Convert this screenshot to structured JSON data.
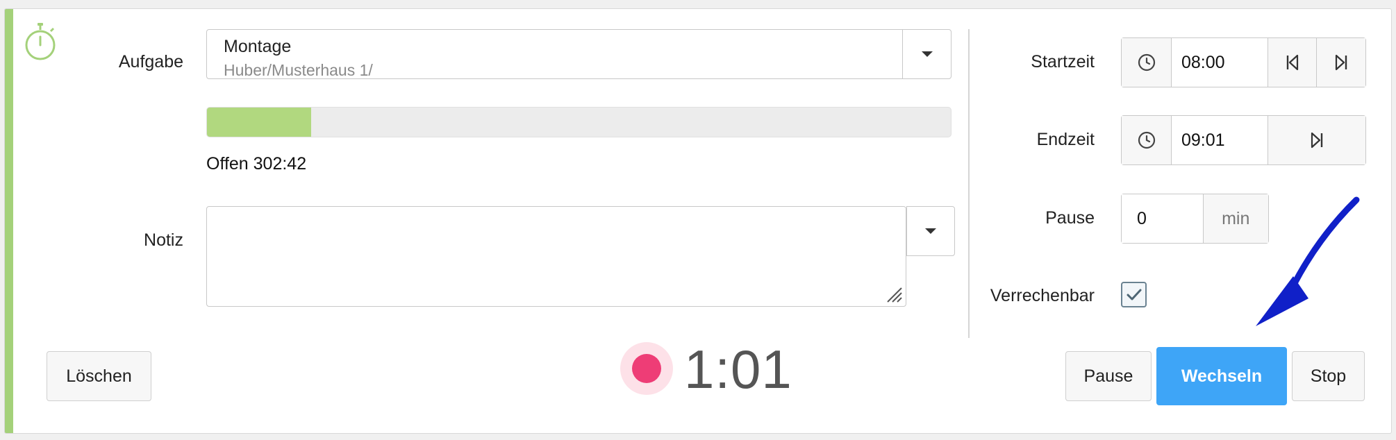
{
  "colors": {
    "accent_green": "#a4d17a",
    "progress_green": "#b1d87f",
    "primary_blue": "#3ea5f7",
    "record_pink": "#ee3d76",
    "annotation_arrow": "#1020c8"
  },
  "form": {
    "aufgabe_label": "Aufgabe",
    "aufgabe_value": "Montage",
    "aufgabe_path": "Huber/Musterhaus 1/",
    "progress_fraction": 0.14,
    "offen_text": "Offen 302:42",
    "notiz_label": "Notiz",
    "notiz_value": ""
  },
  "times": {
    "startzeit_label": "Startzeit",
    "startzeit_value": "08:00",
    "endzeit_label": "Endzeit",
    "endzeit_value": "09:01",
    "pause_label": "Pause",
    "pause_value": "0",
    "pause_unit": "min",
    "verrechenbar_label": "Verrechenbar",
    "verrechenbar_checked": true
  },
  "timer": {
    "elapsed": "1:01",
    "recording": true
  },
  "actions": {
    "loeschen": "Löschen",
    "pause": "Pause",
    "wechseln": "Wechseln",
    "stop": "Stop"
  },
  "icons": {
    "stopwatch": "stopwatch-icon",
    "clock": "clock-icon",
    "skip_back": "skip-back-icon",
    "skip_forward": "skip-forward-icon",
    "caret": "chevron-down-icon",
    "check": "check-icon",
    "arrow": "annotation-arrow-icon"
  }
}
